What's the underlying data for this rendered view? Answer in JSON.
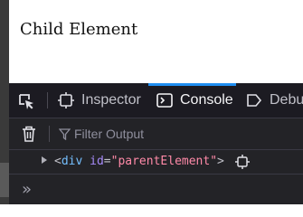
{
  "page": {
    "child_text": "Child Element"
  },
  "devtools": {
    "tabs": [
      {
        "label": "Inspector",
        "icon": "inspector-icon",
        "active": false
      },
      {
        "label": "Console",
        "icon": "console-icon",
        "active": true
      },
      {
        "label": "Debu",
        "icon": "debugger-icon",
        "active": false
      }
    ],
    "filter": {
      "placeholder": "Filter Output"
    },
    "log": {
      "open": "<",
      "tag": "div",
      "attr_name": "id",
      "eq": "=",
      "attr_value": "\"parentElement\"",
      "close": ">"
    },
    "prompt": "»",
    "colors": {
      "accent": "#1f8ef1",
      "tag": "#75bfff",
      "attr": "#a78bfa",
      "value": "#ff8aa8",
      "background": "#232327"
    }
  }
}
